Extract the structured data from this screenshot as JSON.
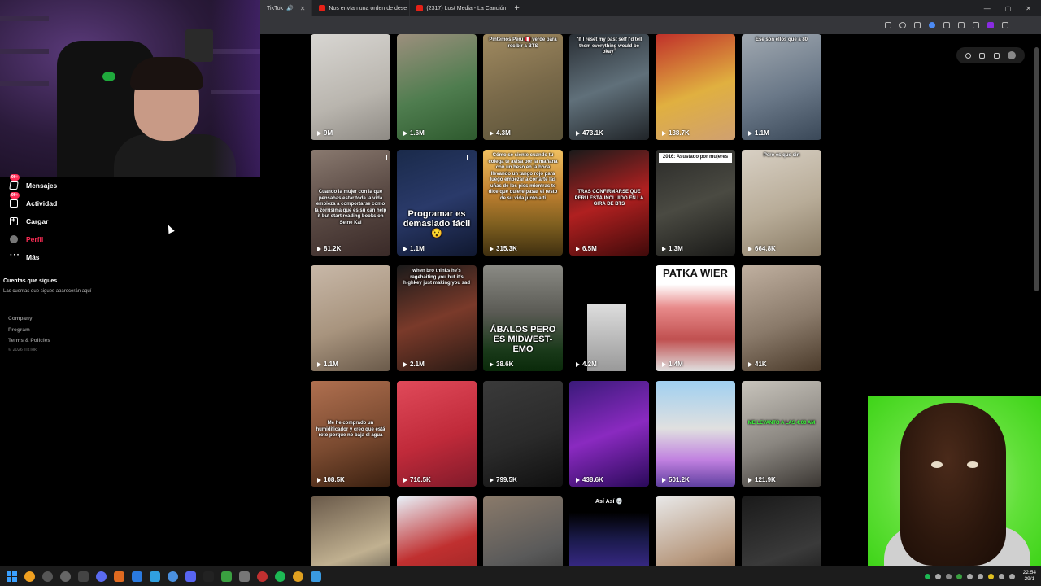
{
  "browser": {
    "tabs": [
      {
        "label": "TikTok",
        "active": true
      },
      {
        "label": "Nos envían una orden de dese",
        "active": false
      },
      {
        "label": "(2317) Lost Media - La Canción",
        "active": false
      }
    ],
    "new_tab": "+",
    "window_controls": [
      "—",
      "▢",
      "✕"
    ]
  },
  "sidebar": {
    "nav": [
      {
        "label": "Mensajes",
        "icon": "message-icon",
        "badge": "99+"
      },
      {
        "label": "Actividad",
        "icon": "activity-icon",
        "badge": "99+"
      },
      {
        "label": "Cargar",
        "icon": "upload-icon",
        "badge": ""
      },
      {
        "label": "Perfil",
        "icon": "avatar-icon",
        "badge": ""
      },
      {
        "label": "Más",
        "icon": "more-icon",
        "badge": ""
      }
    ],
    "following_title": "Cuentas que sigues",
    "following_subtitle": "Las cuentas que sigues aparecerán aquí",
    "footer_links": [
      "Company",
      "Program",
      "Terms & Policies"
    ],
    "copyright": "© 2026 TikTok"
  },
  "videos": [
    {
      "views": "9M",
      "caption": "",
      "bg": "linear-gradient(160deg,#d8d6d2,#b9b5ae 60%,#8e8a84)"
    },
    {
      "views": "1.6M",
      "caption": "",
      "bg": "linear-gradient(160deg,#9c8f7d,#4f7d4f 55%,#2e5a2e)"
    },
    {
      "views": "4.3M",
      "caption": "Pintemos Perú 🇵🇪 verde para recibir a BTS",
      "bg": "linear-gradient(160deg,#a08a60,#7a6a4a 50%,#5a5238)"
    },
    {
      "views": "473.1K",
      "caption": "\"If I reset my past self I'd tell them everything would be okay\"",
      "bg": "linear-gradient(160deg,#2a2f35,#60707a 50%,#202428)"
    },
    {
      "views": "138.7K",
      "caption": "",
      "bg": "linear-gradient(160deg,#c0302a,#e0b040 55%,#d0a070)"
    },
    {
      "views": "1.1M",
      "caption": "Ese son ellos que a 80",
      "bg": "linear-gradient(160deg,#a0a8b0,#6a7888 55%,#3a4858)"
    },
    {
      "views": "81.2K",
      "caption": "Cuando la mujer con la que pensabas estar toda la vida empieza a comportarse como la zorrisima que es su can help it but start reading books on Seine Kai",
      "bg": "linear-gradient(160deg,#8a7a70,#5a4a44 50%,#3a2a28)"
    },
    {
      "views": "1.1M",
      "caption": "Programar es demasiado fácil 😯",
      "bg": "linear-gradient(160deg,#1a2a4a,#2a3a6a 50%,#101830)"
    },
    {
      "views": "315.3K",
      "caption": "Cómo se siente cuando tu colega te avisa por la mañana con un beso en la boca llevando un tango rojo para luego empezar a cortarte las uñas de los pies mientras te dice que quiere pasar el resto de su vida junto a ti",
      "bg": "linear-gradient(180deg,#f0c060,#c08030 40%,#806020 70%,#403010)"
    },
    {
      "views": "6.5M",
      "caption": "TRAS CONFIRMARSE QUE PERÚ ESTÁ INCLUIDO EN LA GIRA DE BTS",
      "bg": "linear-gradient(160deg,#1a1a1a,#b02020 50%,#400a0a)"
    },
    {
      "views": "1.3M",
      "caption": "2016: Asustado por mujeres",
      "bg": "linear-gradient(160deg,#2a2a28,#4a4a42 50%,#1a1a18)"
    },
    {
      "views": "664.8K",
      "caption": "Pero es que sin",
      "bg": "linear-gradient(160deg,#d8d0c4,#b8ac98 55%,#8a7c66)"
    },
    {
      "views": "1.1M",
      "caption": "",
      "bg": "linear-gradient(160deg,#c8b8a8,#a8947e 55%,#6a5a4a)"
    },
    {
      "views": "2.1M",
      "caption": "when bro thinks he's ragebaiting you but it's highkey just making you sad",
      "bg": "linear-gradient(160deg,#1a1a1a,#7a3a2a 50%,#2a1a14)"
    },
    {
      "views": "38.6K",
      "caption": "ÁBALOS PERO ES MIDWEST-EMO",
      "bg": "linear-gradient(180deg,#8a8a84,#5a5a54 45%,#1a3a1a 80%,#0a2a0a)"
    },
    {
      "views": "4.2M",
      "caption": "",
      "bg": "#000000"
    },
    {
      "views": "1.4M",
      "caption": "PATKA WIER",
      "bg": "linear-gradient(180deg,#ffffff 0%,#ffffff 18%,#e88a8a 40%,#c05050 70%,#e0e0e0 100%)"
    },
    {
      "views": "41K",
      "caption": "",
      "bg": "linear-gradient(160deg,#c0b0a0,#8a7a6a 55%,#4a3a2a)"
    },
    {
      "views": "108.5K",
      "caption": "Me he comprado un humidificador y creo que está roto porque no baja el agua",
      "bg": "linear-gradient(160deg,#b07050,#7a4a30 55%,#3a2010)"
    },
    {
      "views": "710.5K",
      "caption": "",
      "bg": "linear-gradient(160deg,#e04a5a,#c02a3a 55%,#801a2a)"
    },
    {
      "views": "799.5K",
      "caption": "",
      "bg": "linear-gradient(160deg,#3a3a3a,#2a2a2a 55%,#101010)"
    },
    {
      "views": "438.6K",
      "caption": "",
      "bg": "linear-gradient(160deg,#3a1a7a,#8a2ac0 50%,#2a0a5a)"
    },
    {
      "views": "501.2K",
      "caption": "",
      "bg": "linear-gradient(180deg,#a0d0f0,#e0e0e0 45%,#c080e0 75%,#6040a0)"
    },
    {
      "views": "121.9K",
      "caption": "ME LEVANTO A LAS 4:00 AM",
      "bg": "linear-gradient(160deg,#c8c4bc,#8a8680 55%,#3a3632)"
    },
    {
      "views": "",
      "caption": "",
      "bg": "linear-gradient(160deg,#6a5a4a,#c0b090 55%,#2a2a2a)"
    },
    {
      "views": "",
      "caption": "",
      "bg": "linear-gradient(160deg,#e8f0f8,#c03030 50%,#8a2020)"
    },
    {
      "views": "",
      "caption": "",
      "bg": "linear-gradient(160deg,#8a7a6a,#5a5a5a 55%,#2a2a2a)"
    },
    {
      "views": "",
      "caption": "Así Así 💀",
      "bg": "linear-gradient(180deg,#000000 0%,#000000 15%,#1a1a4a 40%,#3a2a8a 70%,#1a1a3a)"
    },
    {
      "views": "",
      "caption": "",
      "bg": "linear-gradient(160deg,#e8e8e8,#b89a80 55%,#6a4a30)"
    },
    {
      "views": "",
      "caption": "",
      "bg": "linear-gradient(160deg,#1a1a1a,#3a3a3a 55%,#0a0a0a)"
    }
  ],
  "taskbar": {
    "clock_time": "22:54",
    "clock_date": "29/1"
  }
}
